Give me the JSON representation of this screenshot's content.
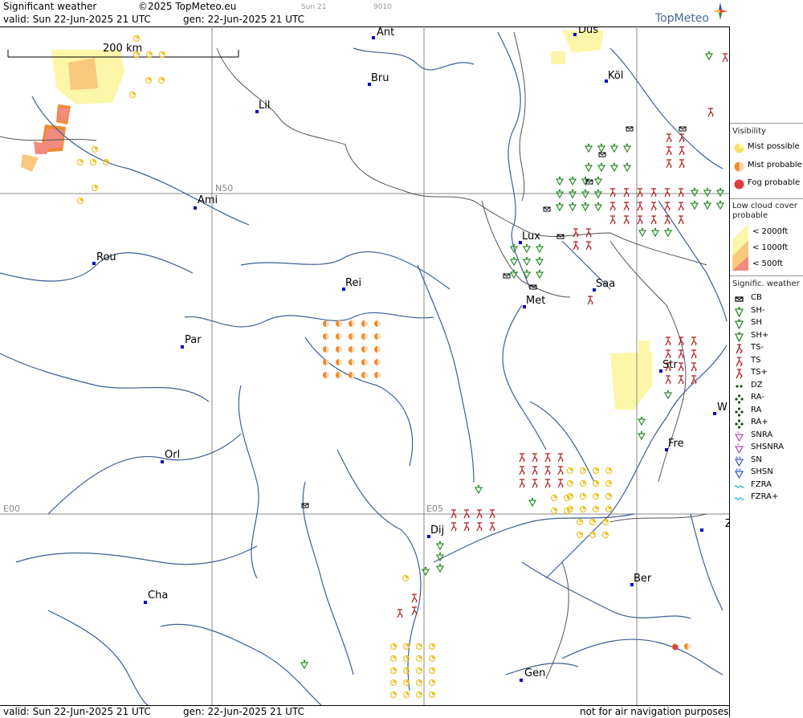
{
  "header": {
    "title": "Significant weather",
    "copyright": "©2025 TopMeteo.eu",
    "sun_label": "Sun 21",
    "code": "9010",
    "valid": "valid:  Sun  22-Jun-2025  21 UTC",
    "gen": "gen: 22-Jun-2025  21 UTC",
    "brand": "TopMeteo"
  },
  "map": {
    "scale_label": "200 km",
    "grid_labels": {
      "n50": "N50",
      "e00": "E00",
      "e05": "E05"
    },
    "cities": [
      {
        "name": "Ant"
      },
      {
        "name": "Düs"
      },
      {
        "name": "Köl"
      },
      {
        "name": "Bru"
      },
      {
        "name": "Lil"
      },
      {
        "name": "Ami"
      },
      {
        "name": "Rou"
      },
      {
        "name": "Lux"
      },
      {
        "name": "Saa"
      },
      {
        "name": "Rei"
      },
      {
        "name": "Met"
      },
      {
        "name": "Par"
      },
      {
        "name": "Str"
      },
      {
        "name": "W"
      },
      {
        "name": "Fre"
      },
      {
        "name": "Orl"
      },
      {
        "name": "Dij"
      },
      {
        "name": "Ber"
      },
      {
        "name": "Cha"
      },
      {
        "name": "Gen"
      },
      {
        "name": "Z"
      }
    ]
  },
  "footer": {
    "valid": "valid:  Sun  22-Jun-2025  21 UTC",
    "gen": "gen: 22-Jun-2025  21 UTC",
    "note": "not for air navigation purposes"
  },
  "legend": {
    "visibility_title": "Visibility",
    "visibility_items": [
      {
        "label": "Mist possible",
        "color": "#f5e060"
      },
      {
        "label": "Mist probable",
        "color": "#f08a30"
      },
      {
        "label": "Fog probable",
        "color": "#e03c3c"
      }
    ],
    "lowcloud_title": "Low cloud cover probable",
    "lowcloud_items": [
      {
        "label": "<  2000ft",
        "color": "#fbf6a8"
      },
      {
        "label": "< 1000ft",
        "color": "#f8c87c"
      },
      {
        "label": "<   500ft",
        "color": "#f28a7e"
      }
    ],
    "weather_title": "Signific. weather",
    "weather_items": [
      {
        "label": "CB",
        "color": "#000000",
        "icon": "cb-icon"
      },
      {
        "label": "SH-",
        "color": "#2a8a2a",
        "icon": "shower-light-icon"
      },
      {
        "label": "SH",
        "color": "#2a8a2a",
        "icon": "shower-icon"
      },
      {
        "label": "SH+",
        "color": "#2a8a2a",
        "icon": "shower-heavy-icon"
      },
      {
        "label": "TS-",
        "color": "#b01818",
        "icon": "thunderstorm-light-icon"
      },
      {
        "label": "TS",
        "color": "#b01818",
        "icon": "thunderstorm-icon"
      },
      {
        "label": "TS+",
        "color": "#b01818",
        "icon": "thunderstorm-heavy-icon"
      },
      {
        "label": "DZ",
        "color": "#1a4a1a",
        "icon": "drizzle-icon"
      },
      {
        "label": "RA-",
        "color": "#1a4a1a",
        "icon": "rain-light-icon"
      },
      {
        "label": "RA",
        "color": "#1a4a1a",
        "icon": "rain-icon"
      },
      {
        "label": "RA+",
        "color": "#1a4a1a",
        "icon": "rain-heavy-icon"
      },
      {
        "label": "SNRA",
        "color": "#c040c0",
        "icon": "snow-rain-icon"
      },
      {
        "label": "SHSNRA",
        "color": "#c040c0",
        "icon": "snow-rain-shower-icon"
      },
      {
        "label": "SN",
        "color": "#3050c8",
        "icon": "snow-icon"
      },
      {
        "label": "SHSN",
        "color": "#3050c8",
        "icon": "snow-shower-icon"
      },
      {
        "label": "FZRA",
        "color": "#30b8d8",
        "icon": "freezing-rain-icon"
      },
      {
        "label": "FZRA+",
        "color": "#30b8d8",
        "icon": "freezing-rain-heavy-icon"
      }
    ]
  }
}
